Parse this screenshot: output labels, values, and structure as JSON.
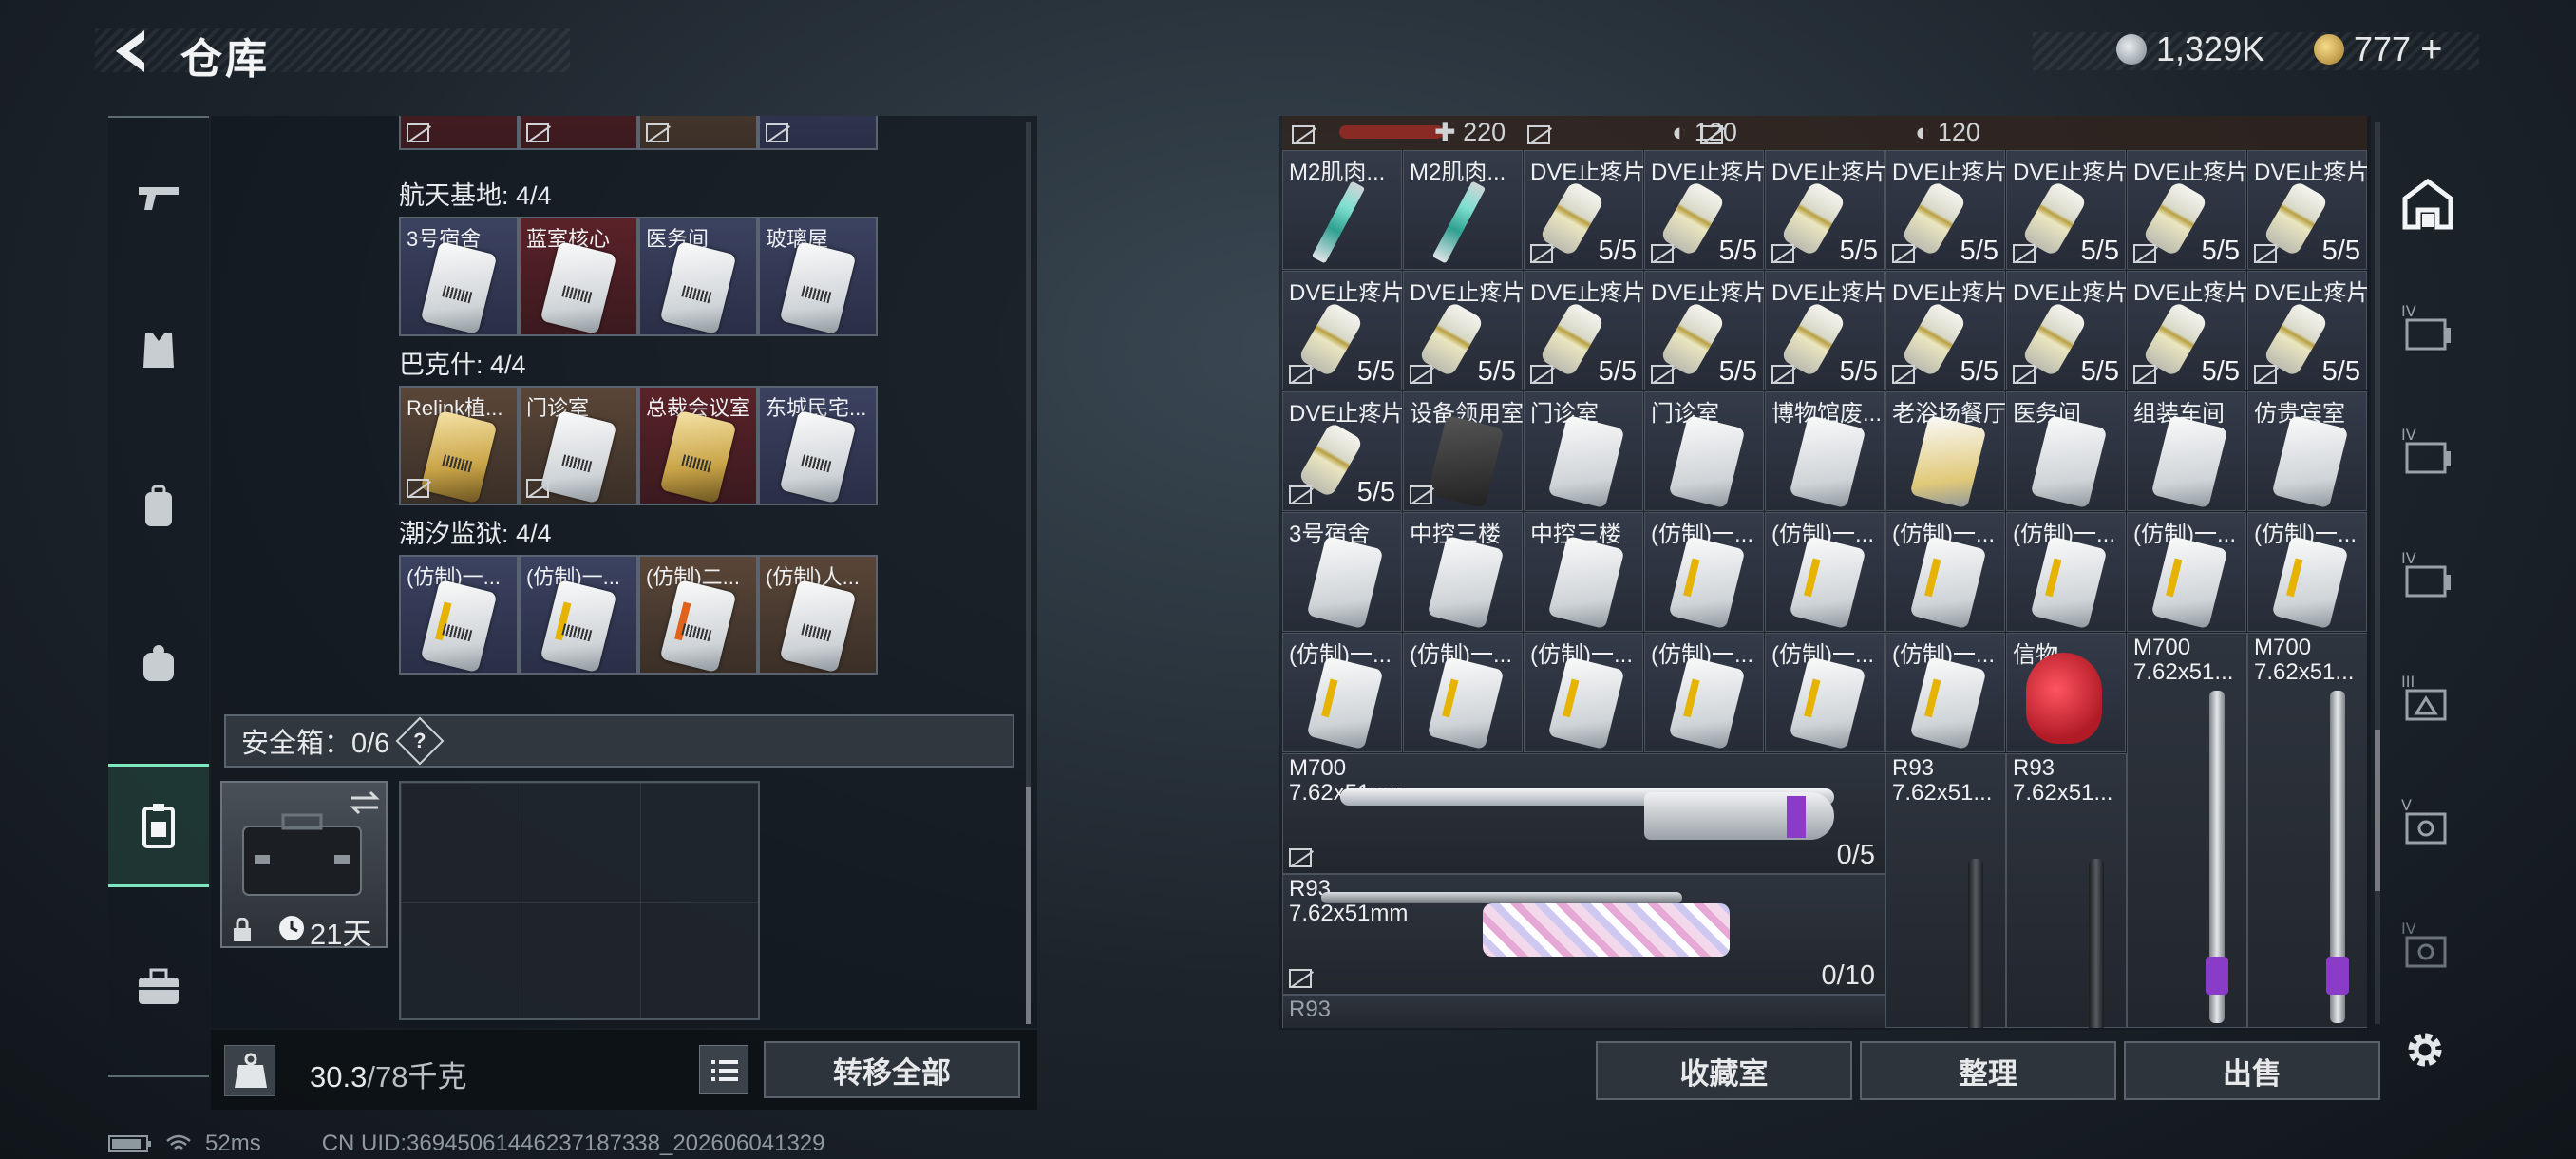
{
  "header": {
    "title": "仓库",
    "currency1": "1,329K",
    "currency2": "777",
    "add": "+"
  },
  "sections": [
    {
      "label": "航天基地: 4/4",
      "items": [
        "3号宿舍",
        "蓝室核心",
        "医务间",
        "玻璃屋"
      ]
    },
    {
      "label": "巴克什: 4/4",
      "items": [
        "Relink植...",
        "门诊室",
        "总裁会议室",
        "东城民宅..."
      ]
    },
    {
      "label": "潮汐监狱: 4/4",
      "items": [
        "(仿制)一...",
        "(仿制)一...",
        "(仿制)二...",
        "(仿制)人..."
      ]
    }
  ],
  "safe": {
    "label": "安全箱：0/6",
    "help": "?",
    "duration": "21天"
  },
  "footer_left": {
    "weight": "30.3",
    "weight_max": "/78千克",
    "transfer": "转移全部"
  },
  "status": {
    "ping": "52ms",
    "uid": "CN UID:3694506144623718733​8_202606041329"
  },
  "stash_top": {
    "v1": "220",
    "v2": "120",
    "v3": "120"
  },
  "stash": {
    "row1": [
      "M2肌肉...",
      "M2肌肉...",
      "DVE止疼片",
      "DVE止疼片",
      "DVE止疼片",
      "DVE止疼片",
      "DVE止疼片",
      "DVE止疼片",
      "DVE止疼片"
    ],
    "row2": [
      "DVE止疼片",
      "DVE止疼片",
      "DVE止疼片",
      "DVE止疼片",
      "DVE止疼片",
      "DVE止疼片",
      "DVE止疼片",
      "DVE止疼片",
      "DVE止疼片"
    ],
    "row3": [
      "DVE止疼片",
      "设备领用室",
      "门诊室",
      "门诊室",
      "博物馆废...",
      "老浴场餐厅",
      "医务间",
      "组装车间",
      "仿贵宾室"
    ],
    "row4": [
      "3号宿舍",
      "中控三楼",
      "中控三楼",
      "(仿制)一...",
      "(仿制)一...",
      "(仿制)一...",
      "(仿制)一...",
      "(仿制)一...",
      "(仿制)一..."
    ],
    "row5": [
      "(仿制)一...",
      "(仿制)一...",
      "(仿制)一...",
      "(仿制)一...",
      "(仿制)一...",
      "(仿制)一...",
      "信物"
    ],
    "pill_count": "5/5",
    "m700a": {
      "name": "M700",
      "cal": "7.62x51...",
      "name2": "M700",
      "cal2": "7.62x51..."
    },
    "m700b": {
      "name": "M700",
      "cal": "7.62x51mm",
      "count": "0/5"
    },
    "r93a": {
      "name": "R93",
      "cal": "7.62x51...",
      "name2": "R93",
      "cal2": "7.62x51..."
    },
    "r93b": {
      "name": "R93",
      "cal": "7.62x51mm",
      "count": "0/10"
    },
    "r93c": {
      "name": "R93"
    }
  },
  "footer_right": {
    "btn1": "收藏室",
    "btn2": "整理",
    "btn3": "出售"
  }
}
